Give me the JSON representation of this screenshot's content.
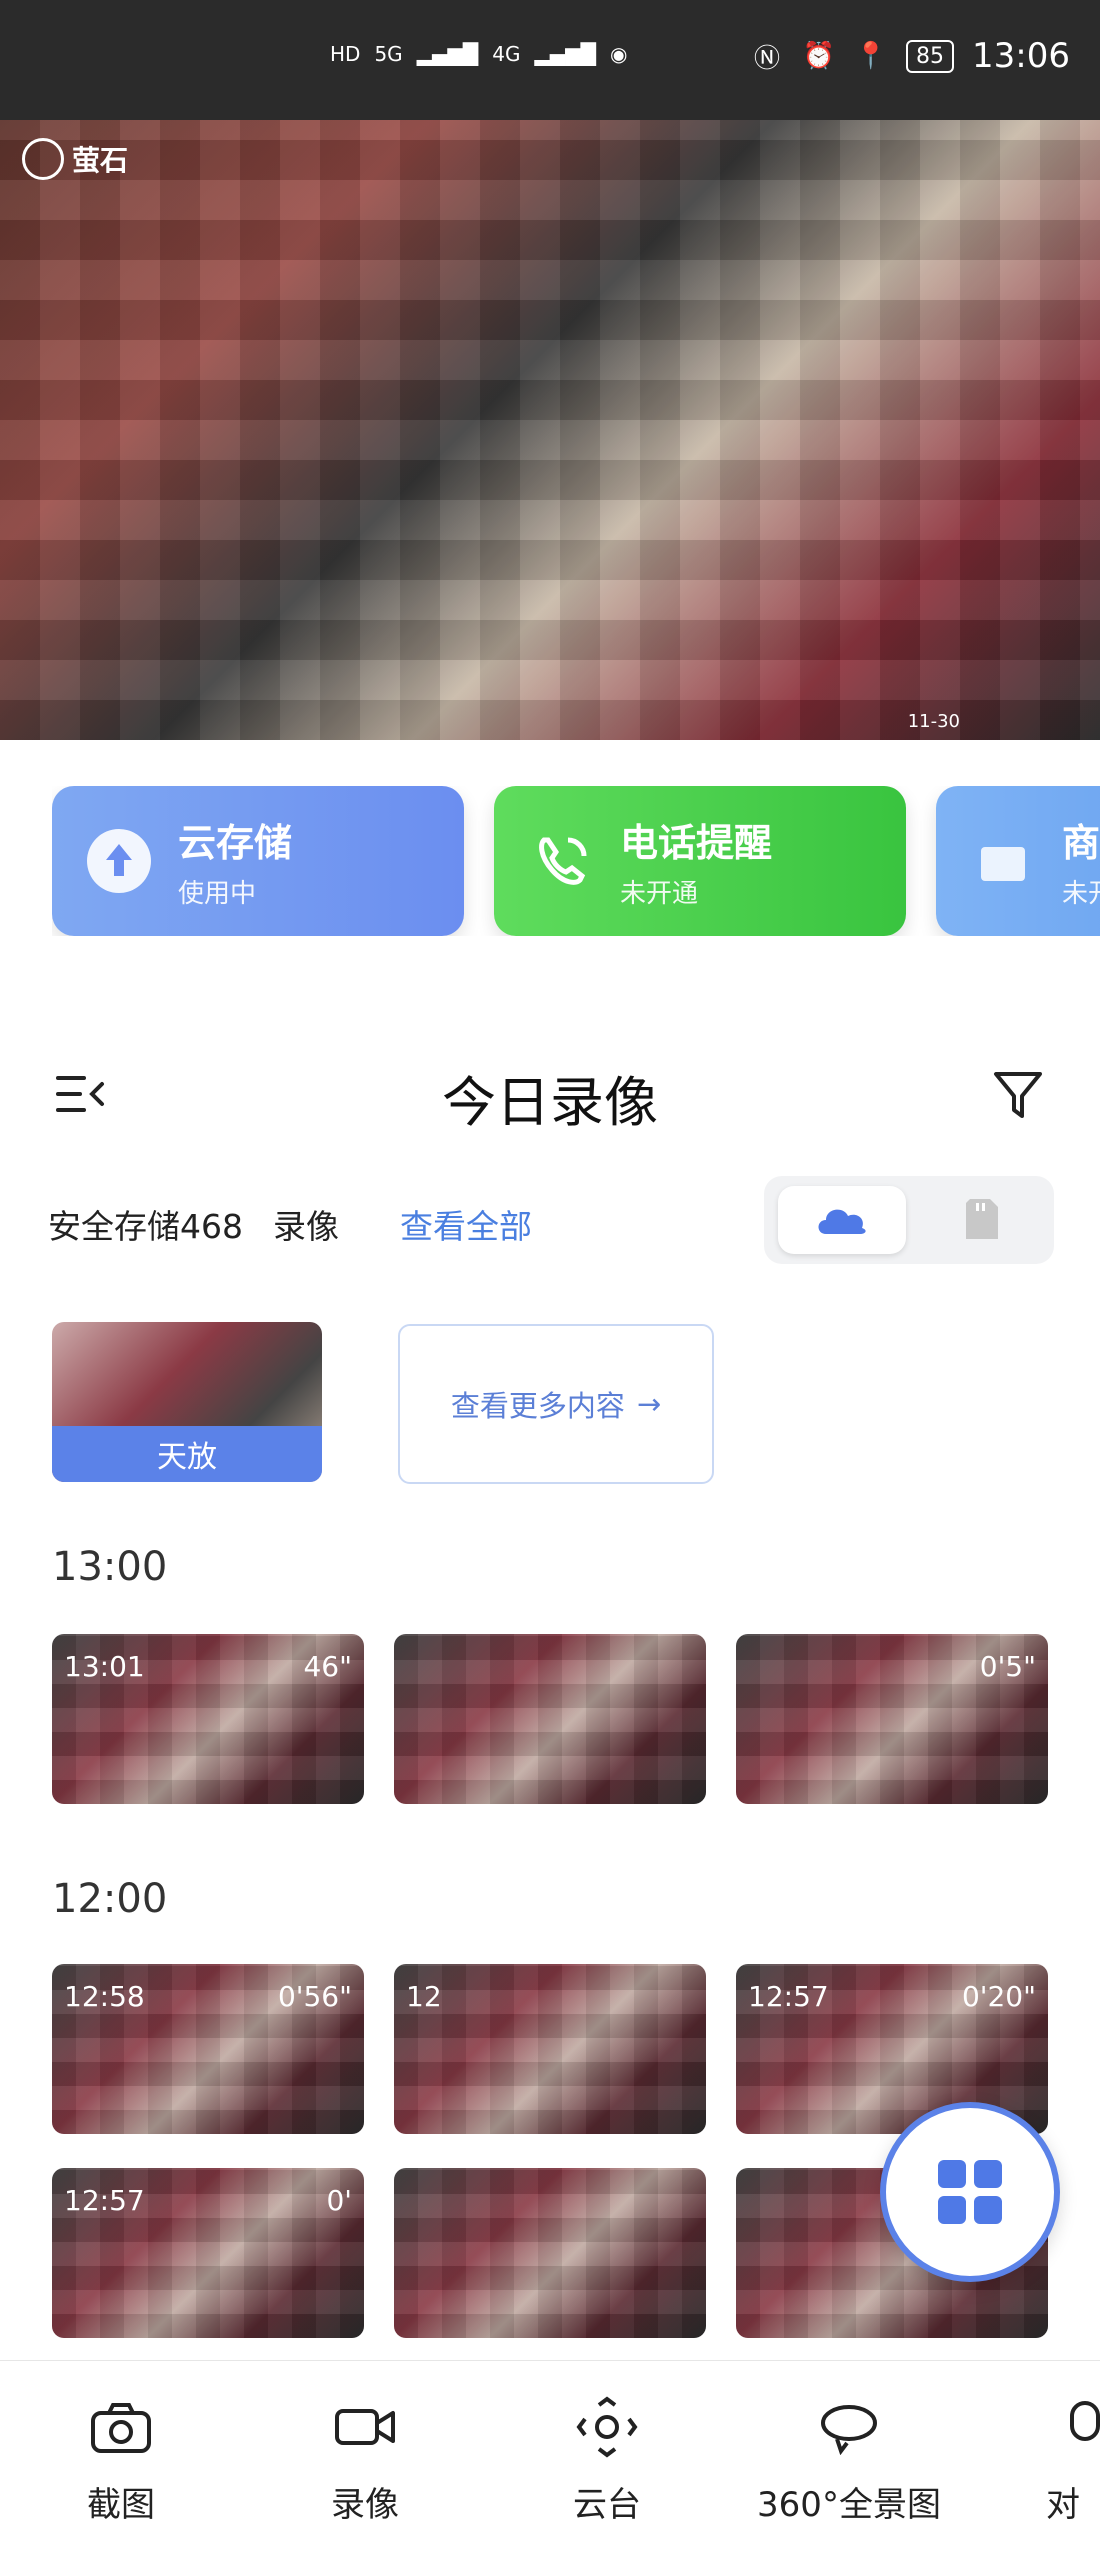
{
  "status_bar": {
    "time": "13:06",
    "battery": "85",
    "net_1": "5G",
    "net_2": "4G"
  },
  "camera_feed": {
    "brand_text": "萤石",
    "timestamp": "11-30"
  },
  "services": [
    {
      "title": "云存储",
      "subtitle": "使用中"
    },
    {
      "title": "电话提醒",
      "subtitle": "未开通"
    },
    {
      "title": "商",
      "subtitle": "未开"
    }
  ],
  "recordings": {
    "title": "今日录像",
    "storage_text": "安全存储468",
    "storage_suffix": "录像",
    "view_all": "查看全部",
    "playback_label": "天放",
    "more_label": "查看更多内容",
    "groups": [
      {
        "label": "13:00",
        "items": [
          {
            "time": "13:01",
            "duration": "46\""
          },
          {
            "time": "",
            "duration": ""
          },
          {
            "time": "",
            "duration": "0'5\""
          }
        ]
      },
      {
        "label": "12:00",
        "items": [
          {
            "time": "12:58",
            "duration": "0'56\""
          },
          {
            "time": "12",
            "duration": ""
          },
          {
            "time": "12:57",
            "duration": "0'20\""
          },
          {
            "time": "12:57",
            "duration": "0'"
          },
          {
            "time": "",
            "duration": ""
          },
          {
            "time": "",
            "duration": ""
          }
        ]
      }
    ]
  },
  "bottom_nav": [
    {
      "label": "截图",
      "icon": "camera-icon"
    },
    {
      "label": "录像",
      "icon": "video-icon"
    },
    {
      "label": "云台",
      "icon": "ptz-icon"
    },
    {
      "label": "360°全景图",
      "icon": "panorama-icon"
    },
    {
      "label": "对",
      "icon": "mic-icon"
    }
  ],
  "colors": {
    "accent": "#5b82e8",
    "cloud_card": "#6b8ef0",
    "phone_card": "#39c43f",
    "link": "#4a7fe0"
  }
}
